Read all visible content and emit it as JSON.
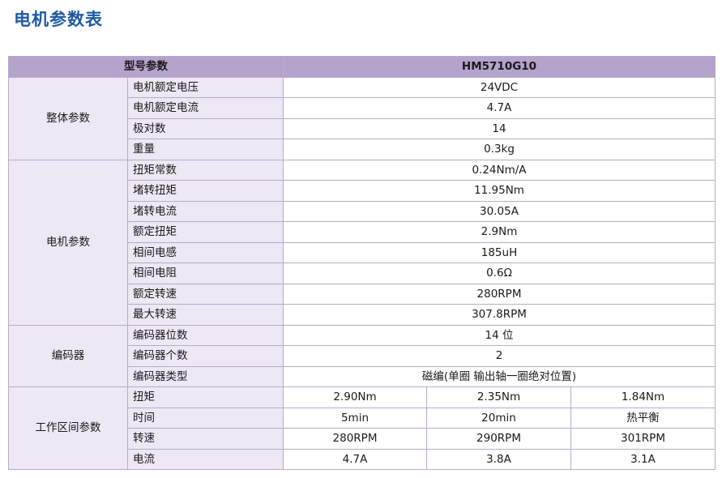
{
  "page": {
    "title": "电机参数表"
  },
  "table": {
    "header": {
      "label": "型号参数",
      "model": "HM5710G10"
    },
    "overall": {
      "group": "整体参数",
      "rows": [
        {
          "name": "电机额定电压",
          "value": "24VDC"
        },
        {
          "name": "电机额定电流",
          "value": "4.7A"
        },
        {
          "name": "极对数",
          "value": "14"
        },
        {
          "name": "重量",
          "value": "0.3kg"
        }
      ]
    },
    "motor": {
      "group": "电机参数",
      "rows": [
        {
          "name": "扭矩常数",
          "value": "0.24Nm/A"
        },
        {
          "name": "堵转扭矩",
          "value": "11.95Nm"
        },
        {
          "name": "堵转电流",
          "value": "30.05A"
        },
        {
          "name": "额定扭矩",
          "value": "2.9Nm"
        },
        {
          "name": "相间电感",
          "value": "185uH"
        },
        {
          "name": "相间电阻",
          "value": "0.6Ω"
        },
        {
          "name": "额定转速",
          "value": "280RPM"
        },
        {
          "name": "最大转速",
          "value": "307.8RPM"
        }
      ]
    },
    "encoder": {
      "group": "编码器",
      "rows": [
        {
          "name": "编码器位数",
          "value": "14 位"
        },
        {
          "name": "编码器个数",
          "value": "2"
        },
        {
          "name": "编码器类型",
          "value": "磁编(单圈 输出轴一圈绝对位置)"
        }
      ]
    },
    "working": {
      "group": "工作区间参数",
      "rows": [
        {
          "name": "扭矩",
          "values": [
            "2.90Nm",
            "2.35Nm",
            "1.84Nm"
          ]
        },
        {
          "name": "时间",
          "values": [
            "5min",
            "20min",
            "热平衡"
          ]
        },
        {
          "name": "转速",
          "values": [
            "280RPM",
            "290RPM",
            "301RPM"
          ]
        },
        {
          "name": "电流",
          "values": [
            "4.7A",
            "3.8A",
            "3.1A"
          ]
        }
      ]
    }
  }
}
